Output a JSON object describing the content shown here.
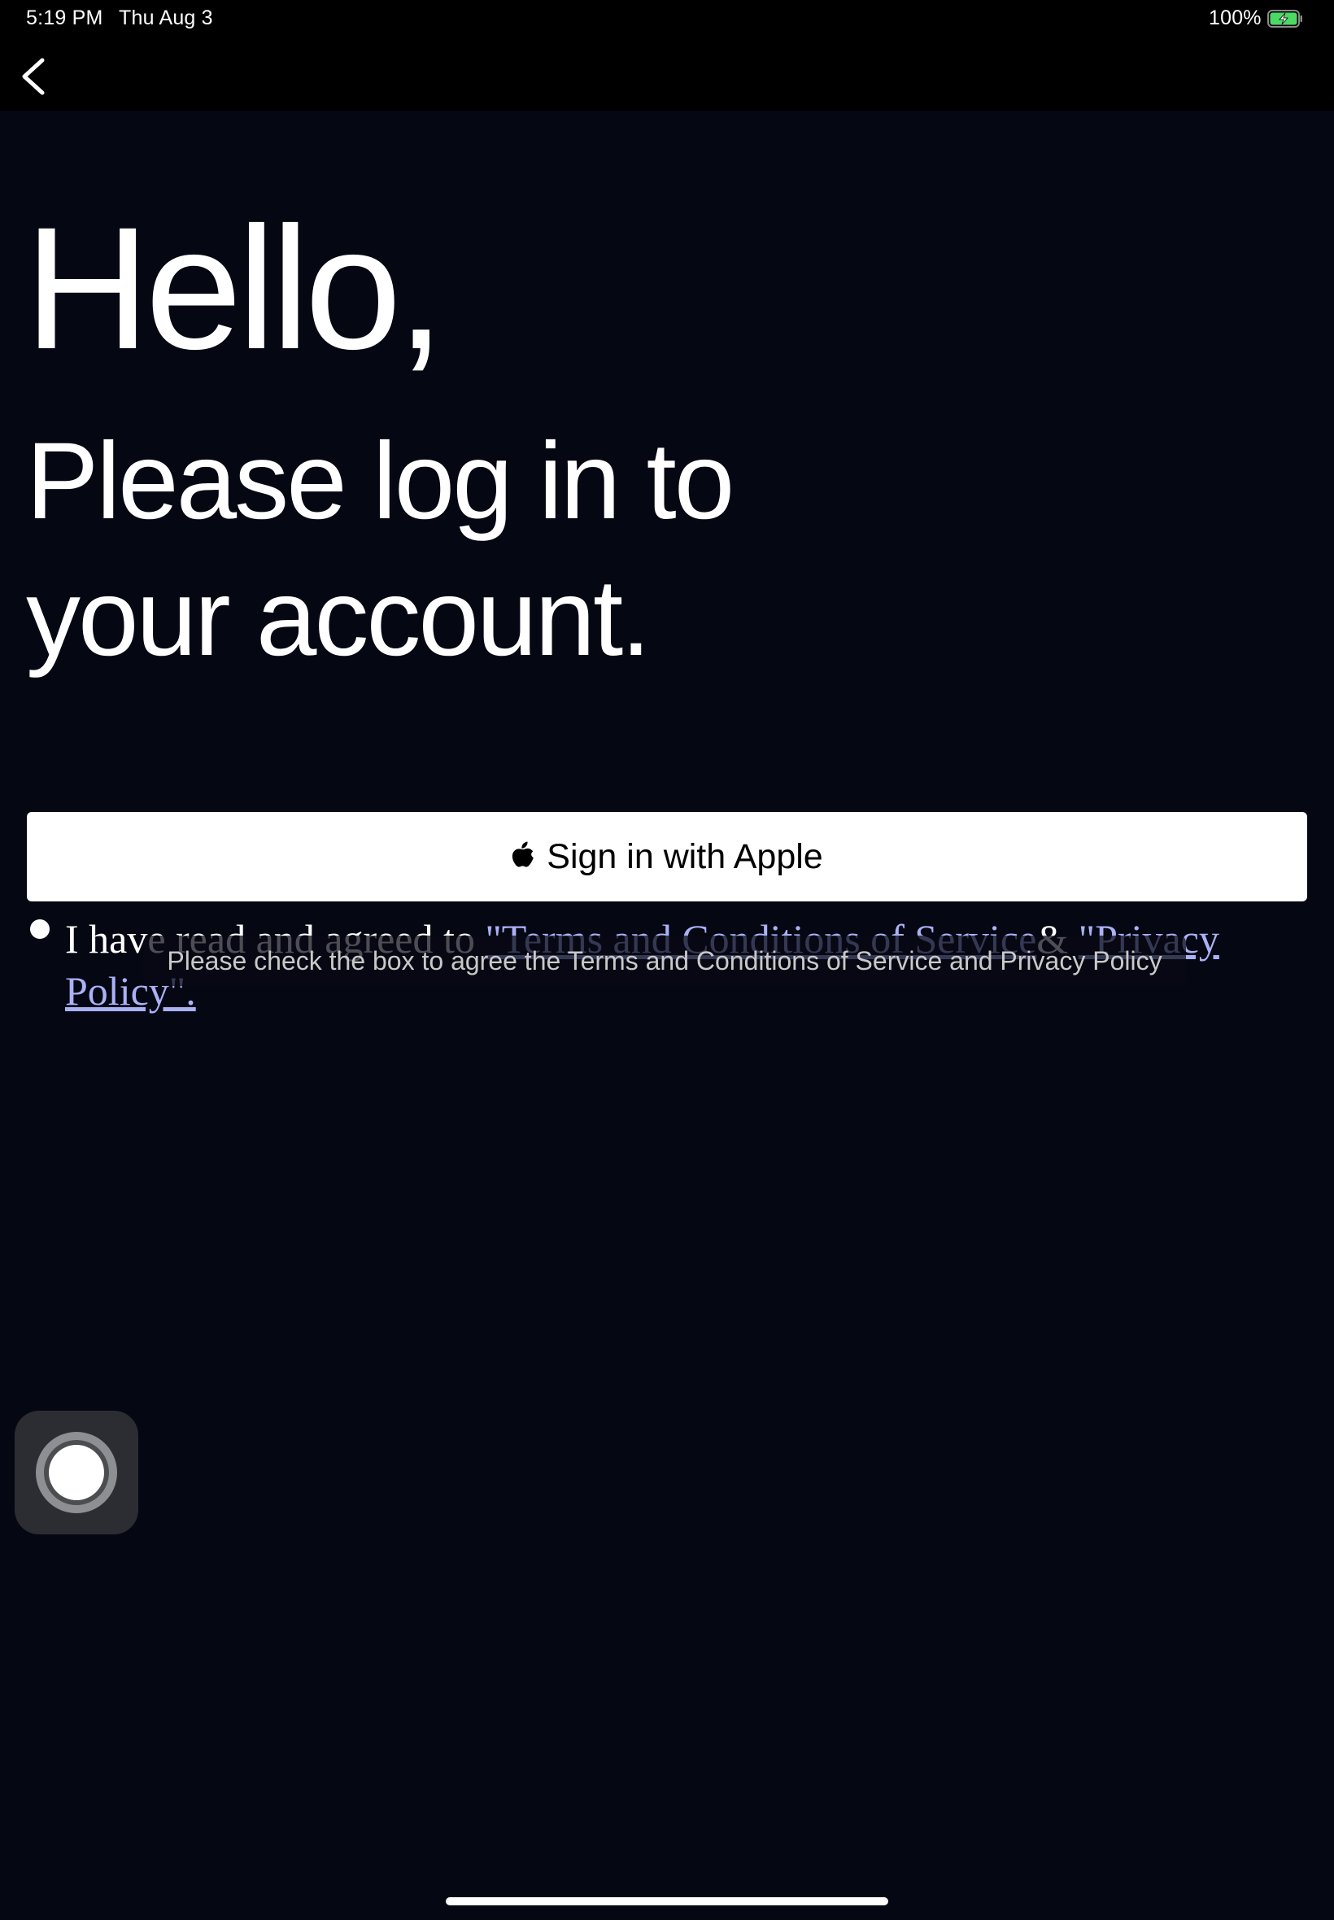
{
  "status_bar": {
    "time": "5:19 PM",
    "date": "Thu Aug 3",
    "battery": "100%",
    "battery_color": "#4cd964",
    "icons": [
      "battery-charging-icon"
    ]
  },
  "nav": {
    "back_icon": "chevron-left-icon"
  },
  "heading": {
    "hello": "Hello,",
    "subtitle_line1": "Please log in to",
    "subtitle_line2": "your account."
  },
  "apple_button": {
    "icon": "apple-logo-icon",
    "label": "Sign in with Apple"
  },
  "terms": {
    "prefix": "I have read and agreed to ",
    "terms_link": "\"Terms and Conditions of Service",
    "separator": "& ",
    "privacy_link": "\"Privacy Policy\".",
    "link_color": "#aab1f5"
  },
  "toast": {
    "message": "Please check the box to agree the Terms and Conditions of Service and Privacy Policy"
  },
  "assistive_touch": {
    "icon": "assistive-touch-icon"
  }
}
